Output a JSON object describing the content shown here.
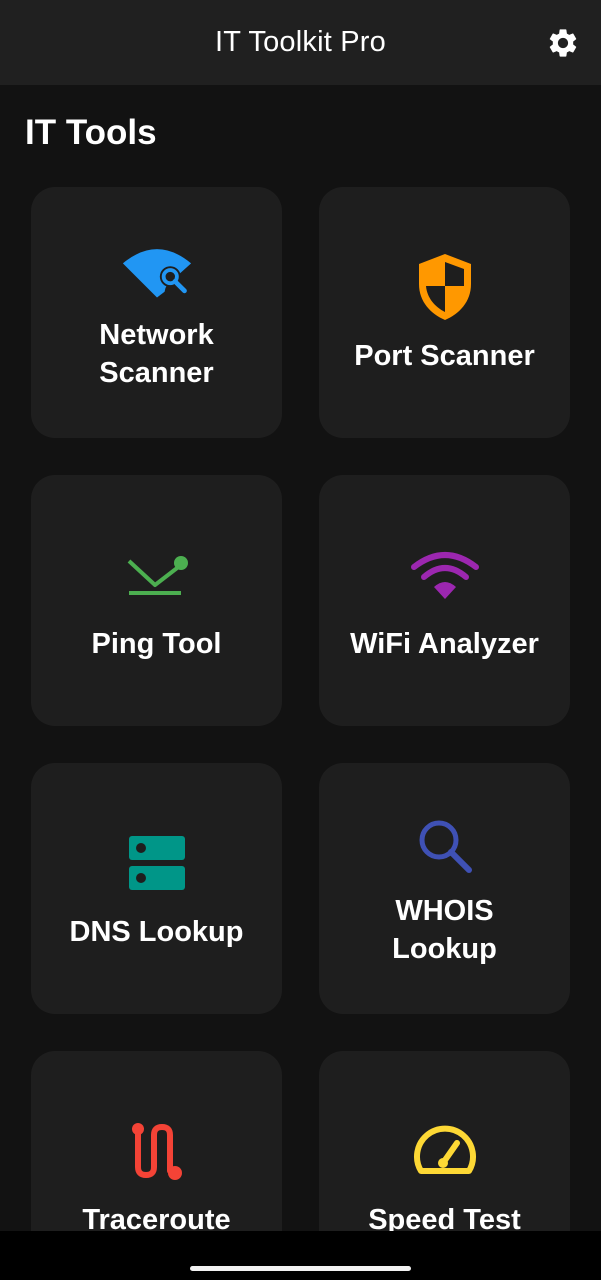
{
  "app": {
    "title": "IT Toolkit Pro",
    "settings_icon": "gear-icon"
  },
  "section": {
    "title": "IT Tools"
  },
  "tools": [
    {
      "label": "Network Scanner",
      "icon": "wifi-search-icon",
      "color": "#2196f3"
    },
    {
      "label": "Port Scanner",
      "icon": "shield-icon",
      "color": "#ff9800"
    },
    {
      "label": "Ping Tool",
      "icon": "ping-icon",
      "color": "#4caf50"
    },
    {
      "label": "WiFi Analyzer",
      "icon": "wifi-icon",
      "color": "#9c27b0"
    },
    {
      "label": "DNS Lookup",
      "icon": "dns-server-icon",
      "color": "#009688"
    },
    {
      "label": "WHOIS Lookup",
      "icon": "magnifier-icon",
      "color": "#3f51b5"
    },
    {
      "label": "Traceroute",
      "icon": "route-icon",
      "color": "#f44336"
    },
    {
      "label": "Speed Test",
      "icon": "speedometer-icon",
      "color": "#fdd835"
    }
  ]
}
